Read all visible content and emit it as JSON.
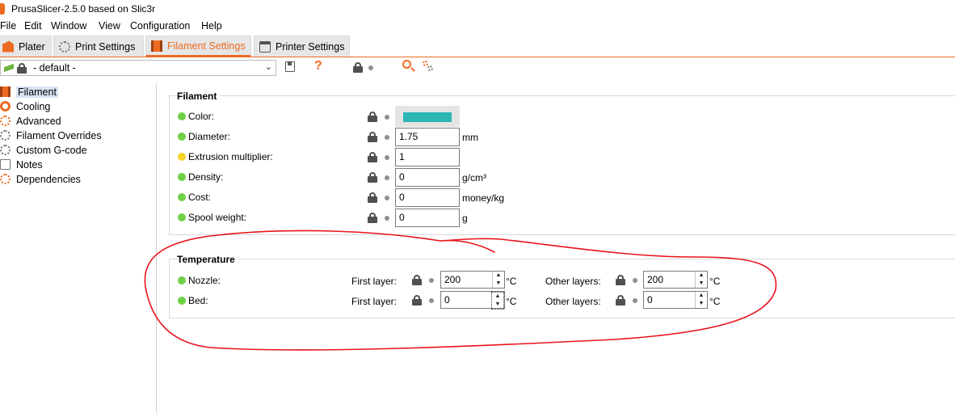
{
  "window": {
    "title": "PrusaSlicer-2.5.0 based on Slic3r"
  },
  "menu": [
    "File",
    "Edit",
    "Window",
    "View",
    "Configuration",
    "Help"
  ],
  "tabs": [
    {
      "label": "Plater",
      "icon": "plater-icon"
    },
    {
      "label": "Print Settings",
      "icon": "print-settings-icon"
    },
    {
      "label": "Filament Settings",
      "icon": "filament-settings-icon",
      "active": true
    },
    {
      "label": "Printer Settings",
      "icon": "printer-settings-icon"
    }
  ],
  "preset": {
    "value": "- default -"
  },
  "toolbar_glyphs": {
    "help": "?",
    "search": "🔍"
  },
  "sidebar": [
    {
      "label": "Filament",
      "selected": true,
      "icon": "filament-icon"
    },
    {
      "label": "Cooling",
      "icon": "cooling-icon"
    },
    {
      "label": "Advanced",
      "icon": "advanced-icon"
    },
    {
      "label": "Filament Overrides",
      "icon": "overrides-icon"
    },
    {
      "label": "Custom G-code",
      "icon": "gcode-icon"
    },
    {
      "label": "Notes",
      "icon": "notes-icon"
    },
    {
      "label": "Dependencies",
      "icon": "dependencies-icon"
    }
  ],
  "filament_group": {
    "title": "Filament",
    "color": {
      "label": "Color:",
      "value": "#2db4b4"
    },
    "diameter": {
      "label": "Diameter:",
      "value": "1.75",
      "unit": "mm"
    },
    "extrusion": {
      "label": "Extrusion multiplier:",
      "value": "1"
    },
    "density": {
      "label": "Density:",
      "value": "0",
      "unit": "g/cm³"
    },
    "cost": {
      "label": "Cost:",
      "value": "0",
      "unit": "money/kg"
    },
    "spool": {
      "label": "Spool weight:",
      "value": "0",
      "unit": "g"
    }
  },
  "temperature_group": {
    "title": "Temperature",
    "first_layer_label": "First layer:",
    "other_layers_label": "Other layers:",
    "unit": "°C",
    "nozzle": {
      "label": "Nozzle:",
      "first": "200",
      "other": "200"
    },
    "bed": {
      "label": "Bed:",
      "first": "0",
      "other": "0"
    }
  },
  "spin_arrows": {
    "up": "▲",
    "down": "▼"
  },
  "colors": {
    "accent": "#ed6b21",
    "green_dot": "#6fcf45",
    "yellow_dot": "#f5d327",
    "annotation": "#e8141b"
  }
}
